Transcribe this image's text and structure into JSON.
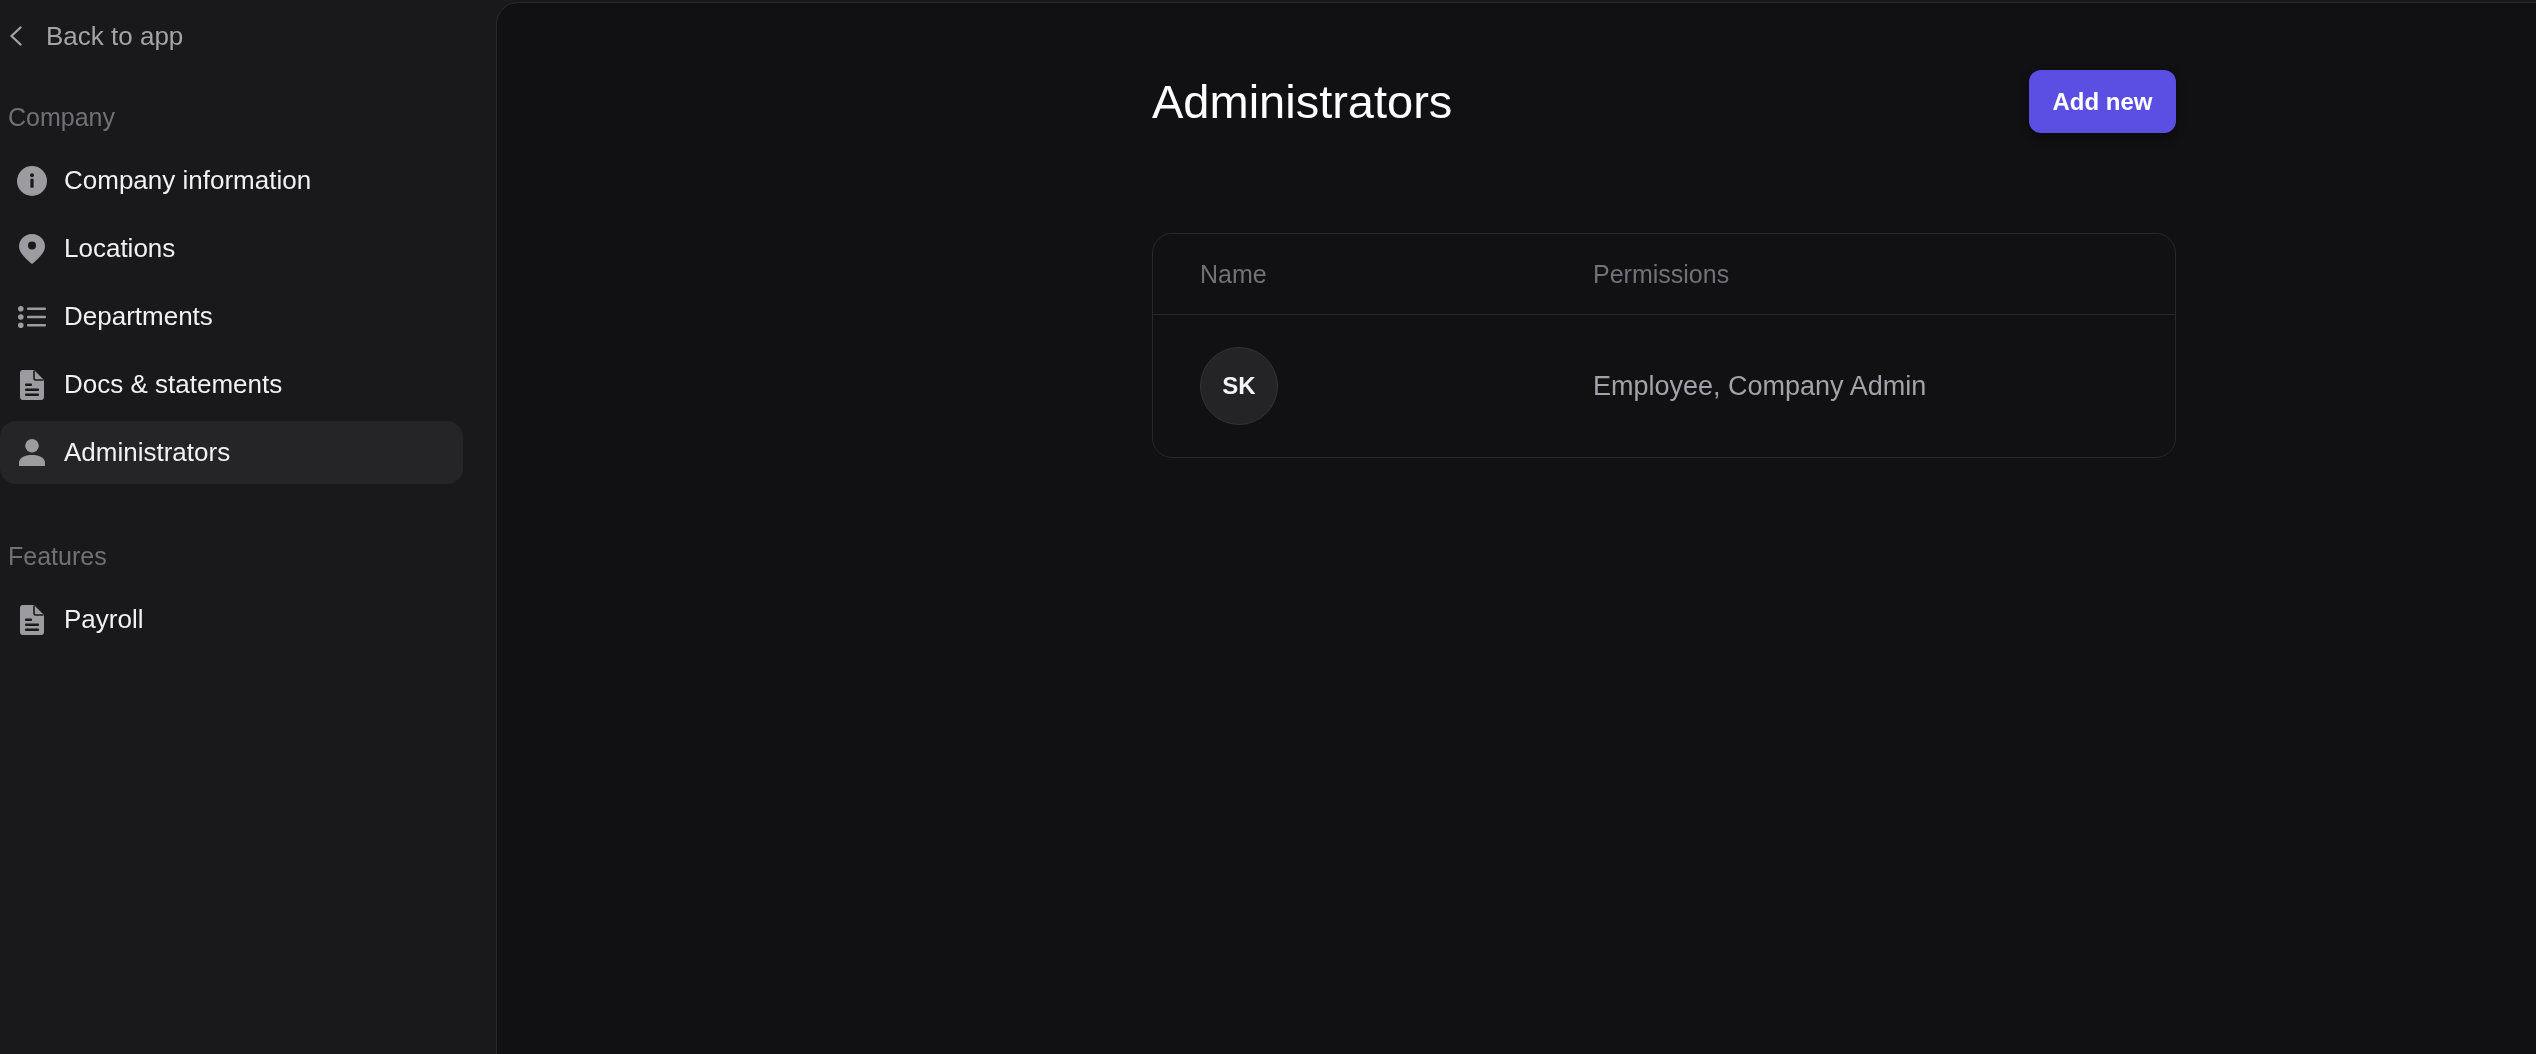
{
  "sidebar": {
    "back_link": "Back to app",
    "sections": [
      {
        "title": "Company",
        "items": [
          {
            "label": "Company information",
            "kind": "info",
            "selected": false
          },
          {
            "label": "Locations",
            "kind": "pin",
            "selected": false
          },
          {
            "label": "Departments",
            "kind": "list",
            "selected": false
          },
          {
            "label": "Docs & statements",
            "kind": "document",
            "selected": false
          },
          {
            "label": "Administrators",
            "kind": "person",
            "selected": true
          }
        ]
      },
      {
        "title": "Features",
        "items": [
          {
            "label": "Payroll",
            "kind": "document",
            "selected": false
          }
        ]
      }
    ]
  },
  "page": {
    "title": "Administrators",
    "add_button": "Add new"
  },
  "table": {
    "columns": [
      "Name",
      "Permissions"
    ],
    "rows": [
      {
        "initials": "SK",
        "permissions": "Employee, Company Admin"
      }
    ]
  }
}
